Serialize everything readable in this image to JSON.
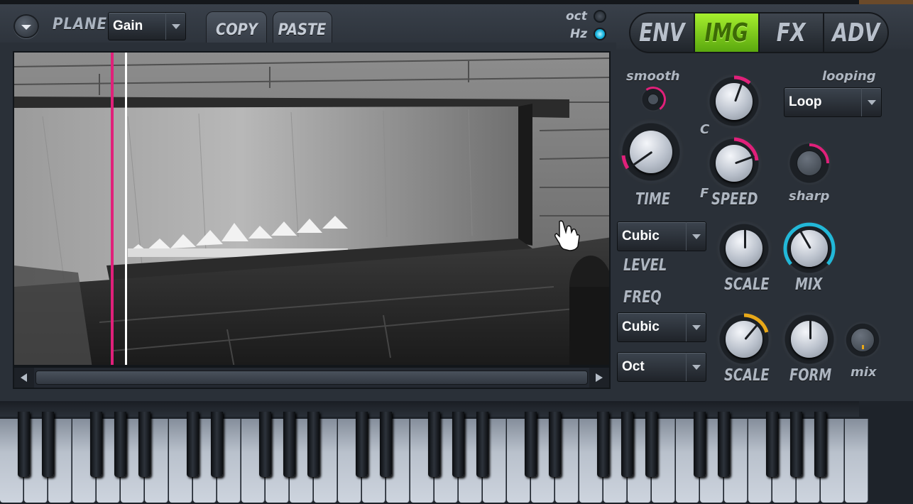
{
  "toolbar": {
    "plane_label": "PLANE",
    "plane_value": "Gain",
    "copy_label": "COPY",
    "paste_label": "PASTE",
    "oct_label": "oct",
    "hz_label": "Hz",
    "hz_active": true
  },
  "mode_tabs": [
    {
      "label": "ENV",
      "active": false
    },
    {
      "label": "IMG",
      "active": true
    },
    {
      "label": "FX",
      "active": false
    },
    {
      "label": "ADV",
      "active": false
    }
  ],
  "controls": {
    "smooth_label": "smooth",
    "looping_label": "looping",
    "looping_value": "Loop",
    "time_label": "TIME",
    "c_label": "C",
    "f_label": "F",
    "speed_label": "SPEED",
    "sharp_label": "sharp",
    "level_interp_value": "Cubic",
    "level_label": "LEVEL",
    "level_scale_label": "SCALE",
    "mix_label": "MIX",
    "freq_label": "FREQ",
    "freq_interp_value": "Cubic",
    "freq_unit_value": "Oct",
    "freq_scale_label": "SCALE",
    "form_label": "FORM",
    "small_mix_label": "mix"
  },
  "colors": {
    "accent_green": "#8fdc1c",
    "marker_pink": "#e0207a",
    "mix_cyan": "#22b8d8",
    "scale_orange": "#e8a818"
  },
  "icons": [
    "menu-arrow-icon",
    "chevron-down-icon",
    "hand-cursor-icon",
    "scroll-left-icon",
    "scroll-right-icon"
  ]
}
